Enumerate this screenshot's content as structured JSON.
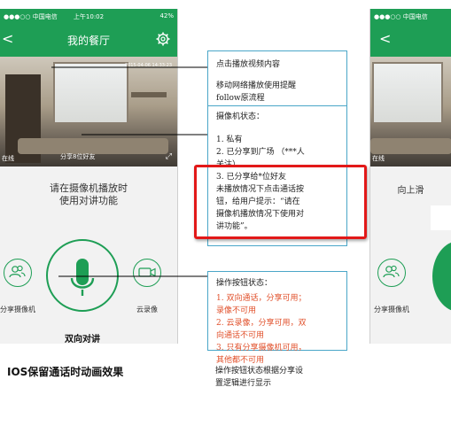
{
  "left_phone": {
    "status": {
      "carrier": "●●●○○ 中国电信 ",
      "time": "上午10:02",
      "battery": "42%"
    },
    "nav": {
      "back": "<",
      "title": "我的餐厅"
    },
    "video": {
      "timestamp": "2015-04-06 14:33:23",
      "watching": "分享8位好友",
      "location": "在线"
    },
    "hint": [
      "请在摄像机播放时",
      "使用对讲功能"
    ],
    "buttons": {
      "share": "分享摄像机",
      "talk": "双向对讲",
      "cloud": "云录像"
    }
  },
  "right_phone": {
    "status": {
      "carrier": "●●●○○ 中国电信 "
    },
    "nav": {
      "back": "<"
    },
    "video": {
      "location": "在线"
    },
    "hint": "向上滑",
    "buttons": {
      "share": "分享摄像机"
    }
  },
  "caption": "IOS保留通话时动画效果",
  "annotations": {
    "a1_lines": [
      "点击播放视频内容"
    ],
    "a2_lines": [
      "移动网络播放使用提醒",
      "follow原流程"
    ],
    "a3_title": "摄像机状态：",
    "a3_lines": [
      "1.  私有",
      "2.  已分享到广场  （***人",
      "     关注）",
      "3.  已分享给*位好友"
    ],
    "a3_note": [
      "   未播放情况下点击通话按",
      "钮，给用户提示：“请在",
      "摄像机播放情况下使用对",
      "讲功能”。"
    ],
    "a4_title": "操作按钮状态：",
    "a4_lines": [
      "1.  双向通话，分享可用；",
      "录像不可用",
      "2.  云录像，分享可用，双",
      "向通话不可用",
      "3.  只有分享摄像机可用，",
      "其他都不可用"
    ]
  },
  "footnote": [
    "操作按钮状态根据分享设",
    "置逻辑进行显示"
  ],
  "colors": {
    "brand_green": "#1e9e55",
    "highlight_red": "#e21818",
    "annotation_orange": "#e1502b",
    "annotation_border": "#4aa6c8"
  }
}
